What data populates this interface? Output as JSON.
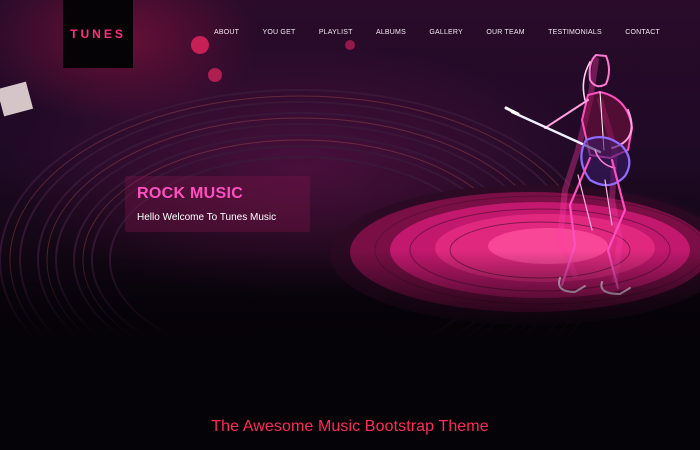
{
  "brand": {
    "logo_text": "TUNES",
    "accent_color": "#ff2e7e"
  },
  "nav": {
    "items": [
      {
        "label": "ABOUT"
      },
      {
        "label": "YOU GET"
      },
      {
        "label": "PLAYLIST"
      },
      {
        "label": "ALBUMS"
      },
      {
        "label": "GALLERY"
      },
      {
        "label": "OUR TEAM"
      },
      {
        "label": "TESTIMONIALS"
      },
      {
        "label": "CONTACT"
      }
    ]
  },
  "hero": {
    "title": "ROCK MUSIC",
    "subtitle": "Hello Welcome To Tunes Music",
    "title_color": "#ff4fc0",
    "illustration": "neon-guitarist-illustration",
    "background": "vinyl-record-background"
  },
  "section": {
    "heading": "The Awesome Music Bootstrap Theme",
    "heading_color": "#ff2a5a"
  }
}
